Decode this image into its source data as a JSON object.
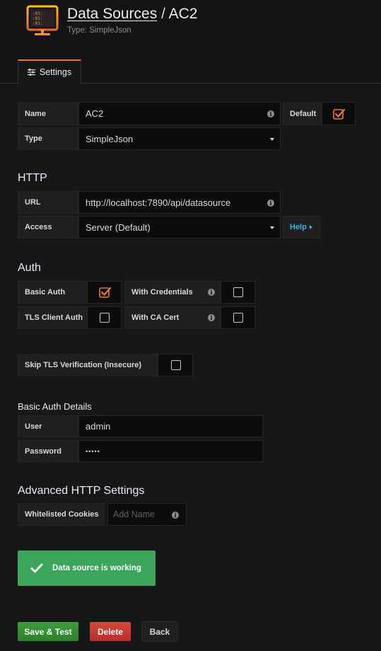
{
  "header": {
    "breadcrumb": "Data Sources",
    "separator": "/",
    "title": "AC2",
    "subtitle": "Type: SimpleJson",
    "icon": "datasource-monitor-icon"
  },
  "tabs": [
    {
      "label": "Settings",
      "icon": "sliders-icon",
      "active": true
    }
  ],
  "basic": {
    "name_label": "Name",
    "name_value": "AC2",
    "default_label": "Default",
    "default_checked": true,
    "type_label": "Type",
    "type_value": "SimpleJson"
  },
  "http": {
    "heading": "HTTP",
    "url_label": "URL",
    "url_value": "http://localhost:7890/api/datasource",
    "access_label": "Access",
    "access_value": "Server (Default)",
    "help_label": "Help"
  },
  "auth": {
    "heading": "Auth",
    "basic_auth_label": "Basic Auth",
    "basic_auth_checked": true,
    "with_credentials_label": "With Credentials",
    "with_credentials_checked": false,
    "tls_client_auth_label": "TLS Client Auth",
    "tls_client_auth_checked": false,
    "with_ca_cert_label": "With CA Cert",
    "with_ca_cert_checked": false,
    "skip_tls_label": "Skip TLS Verification (Insecure)",
    "skip_tls_checked": false
  },
  "basic_auth_details": {
    "heading": "Basic Auth Details",
    "user_label": "User",
    "user_value": "admin",
    "password_label": "Password",
    "password_value": "•••••"
  },
  "advanced": {
    "heading": "Advanced HTTP Settings",
    "cookies_label": "Whitelisted Cookies",
    "cookies_placeholder": "Add Name"
  },
  "alert": {
    "text": "Data source is working",
    "icon": "check-icon"
  },
  "buttons": {
    "save": "Save & Test",
    "delete": "Delete",
    "back": "Back"
  },
  "colors": {
    "accent": "#eb7b18",
    "success": "#3aa65a",
    "save": "#3f9c3e",
    "delete": "#d44a3a",
    "link": "#33b5e5"
  }
}
